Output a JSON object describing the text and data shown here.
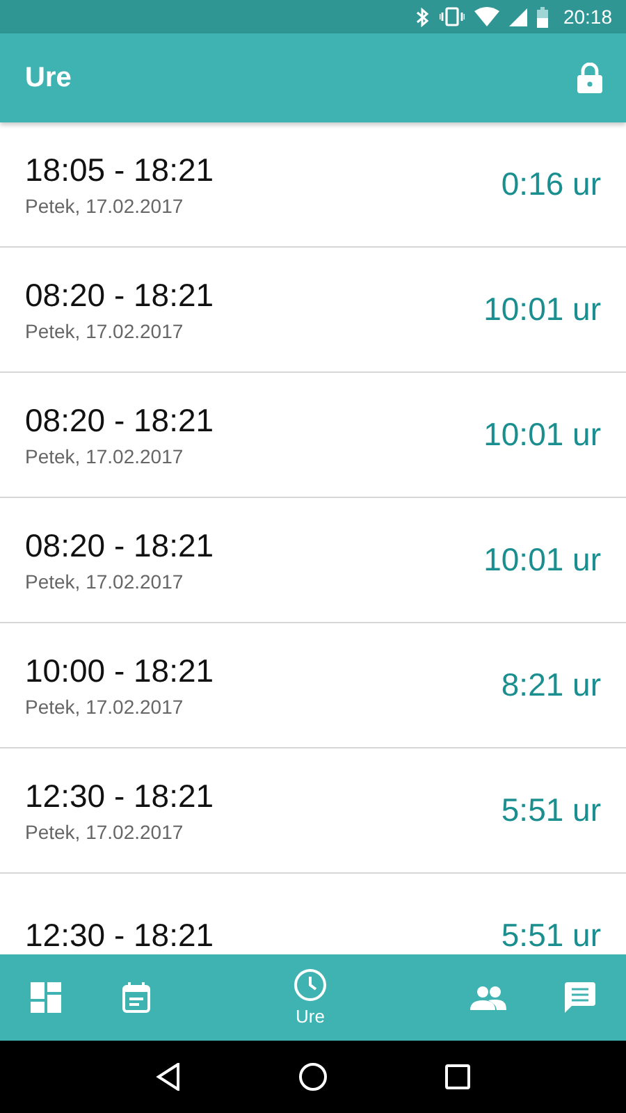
{
  "status_bar": {
    "time": "20:18"
  },
  "app_bar": {
    "title": "Ure"
  },
  "entries": [
    {
      "range": "18:05 - 18:21",
      "date": "Petek, 17.02.2017",
      "duration": "0:16 ur"
    },
    {
      "range": "08:20 - 18:21",
      "date": "Petek, 17.02.2017",
      "duration": "10:01 ur"
    },
    {
      "range": "08:20 - 18:21",
      "date": "Petek, 17.02.2017",
      "duration": "10:01 ur"
    },
    {
      "range": "08:20 - 18:21",
      "date": "Petek, 17.02.2017",
      "duration": "10:01 ur"
    },
    {
      "range": "10:00 - 18:21",
      "date": "Petek, 17.02.2017",
      "duration": "8:21 ur"
    },
    {
      "range": "12:30 - 18:21",
      "date": "Petek, 17.02.2017",
      "duration": "5:51 ur"
    },
    {
      "range": "12:30 - 18:21",
      "duration": "5:51 ur"
    }
  ],
  "bottom_nav": [
    {
      "kind": "dashboard",
      "selected": false
    },
    {
      "kind": "calendar",
      "selected": false
    },
    {
      "kind": "clock",
      "label": "Ure",
      "selected": true
    },
    {
      "kind": "people",
      "selected": false
    },
    {
      "kind": "chat",
      "selected": false
    }
  ]
}
